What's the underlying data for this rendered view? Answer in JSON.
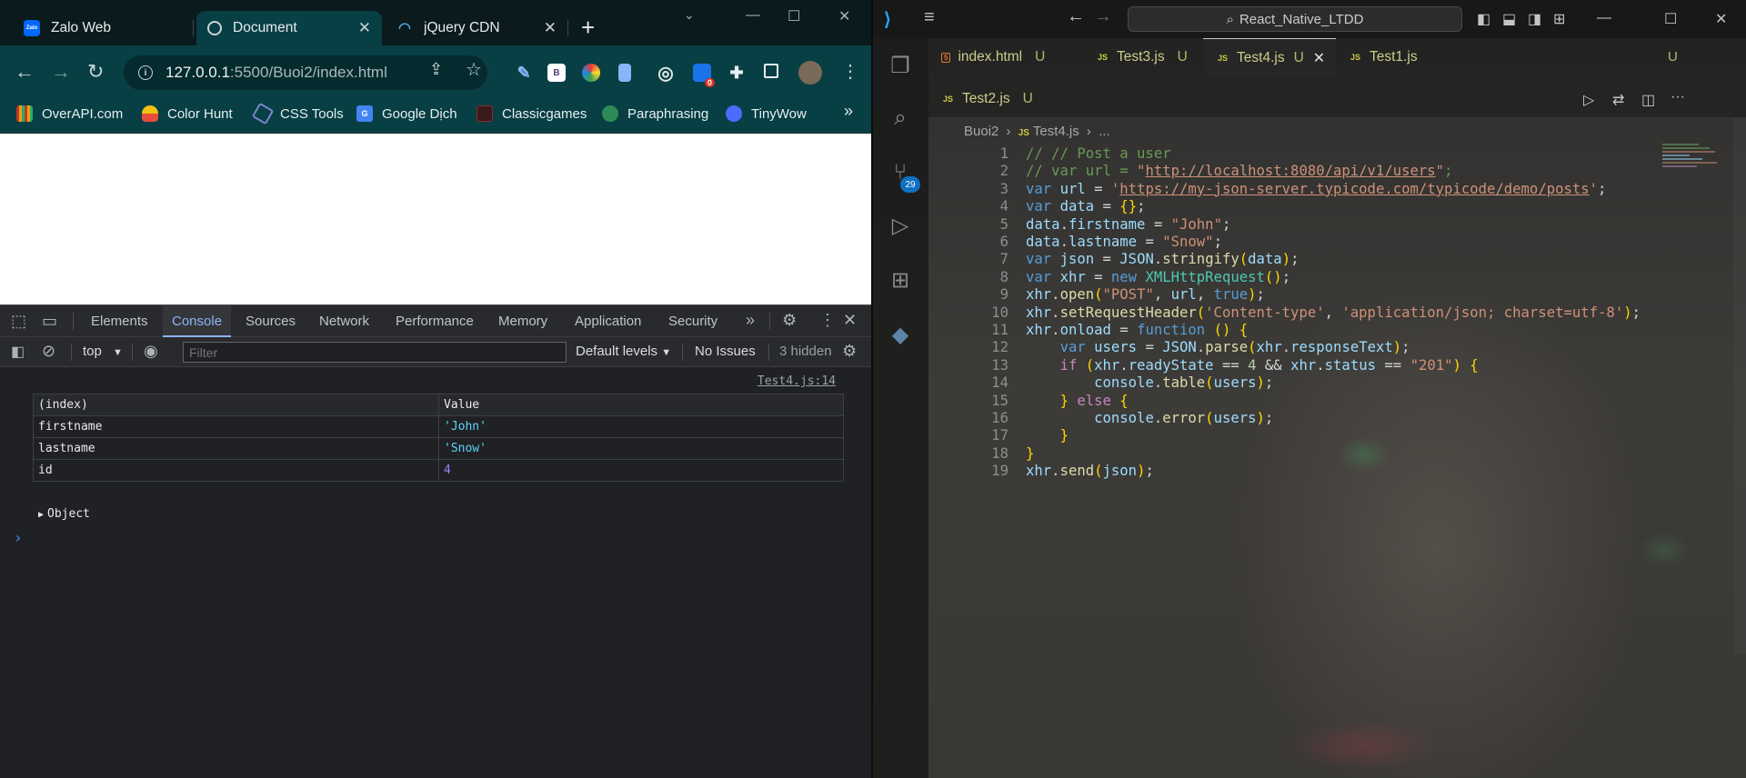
{
  "chrome": {
    "tabs": [
      {
        "title": "Zalo Web",
        "favicon": "zalo-icon",
        "fav_color": "#0068ff",
        "fav_text": "Zalo",
        "active": false
      },
      {
        "title": "Document",
        "favicon": "globe-icon",
        "fav_color": "#5f6368",
        "fav_text": "",
        "active": true
      },
      {
        "title": "jQuery CDN",
        "favicon": "jquery-icon",
        "fav_color": "#0769ad",
        "fav_text": "",
        "active": false
      }
    ],
    "new_tab_symbol": "+",
    "window_controls": {
      "minimize": "—",
      "restore": "☐",
      "collapse": "⌄"
    },
    "nav": {
      "back": "←",
      "forward": "→",
      "reload": "↻"
    },
    "url": {
      "host": "127.0.0.1",
      "path": ":5500/Buoi2/index.html"
    },
    "omnibox_icons": {
      "share": "⇪",
      "star": "☆"
    },
    "extensions": [
      {
        "name": "eyedropper-extension-icon",
        "label": "",
        "color": "#3c6a9c"
      },
      {
        "name": "bootstrap-extension-icon",
        "label": "B",
        "color": "#ffffff"
      },
      {
        "name": "color-wheel-extension-icon",
        "label": "",
        "color": "#2e7d32"
      },
      {
        "name": "clipboard-extension-icon",
        "label": "",
        "color": "#8ab4f8"
      },
      {
        "name": "target-extension-icon",
        "label": "◎",
        "color": "#6b7a7c"
      },
      {
        "name": "ublock-extension-icon",
        "label": "0",
        "color": "#1a73e8"
      },
      {
        "name": "puzzle-icon",
        "label": "✚",
        "color": "#073f44"
      },
      {
        "name": "sidepanel-icon",
        "label": "",
        "color": "#073f44"
      },
      {
        "name": "profile-avatar-icon",
        "label": "",
        "color": "#7a6a5a"
      }
    ],
    "menu_symbol": "⋮",
    "bookmarks": [
      {
        "label": "OverAPI.com",
        "icon": "overapi-icon",
        "color": "#c0392b"
      },
      {
        "label": "Color Hunt",
        "icon": "colorhunt-icon",
        "color": "#f1c40f"
      },
      {
        "label": "CSS Tools",
        "icon": "csstools-icon",
        "color": "#3949ab"
      },
      {
        "label": "Google Dịch",
        "icon": "google-translate-icon",
        "color": "#4285f4"
      },
      {
        "label": "Classicgames",
        "icon": "classicgames-icon",
        "color": "#8e2a2a"
      },
      {
        "label": "Paraphrasing",
        "icon": "paraphrasing-icon",
        "color": "#2e8b57"
      },
      {
        "label": "TinyWow",
        "icon": "tinywow-icon",
        "color": "#4d6bfe"
      }
    ],
    "bookmarks_more": "»"
  },
  "devtools": {
    "tabs": [
      "Elements",
      "Console",
      "Sources",
      "Network",
      "Performance",
      "Memory",
      "Application",
      "Security"
    ],
    "active_tab": "Console",
    "more_tabs_symbol": "»",
    "context": "top",
    "filter_placeholder": "Filter",
    "levels": "Default levels",
    "issues": "No Issues",
    "hidden": "3 hidden",
    "console": {
      "source_link": "Test4.js:14",
      "table": {
        "headers": [
          "(index)",
          "Value"
        ],
        "rows": [
          {
            "key": "firstname",
            "value": "'John'",
            "type": "string"
          },
          {
            "key": "lastname",
            "value": "'Snow'",
            "type": "string"
          },
          {
            "key": "id",
            "value": "4",
            "type": "number"
          }
        ]
      },
      "object_label": "Object",
      "prompt_symbol": "›"
    }
  },
  "vscode": {
    "search": "React_Native_LTDD",
    "tabs_row1": [
      {
        "name": "index.html",
        "type": "html",
        "status": "U",
        "active": false
      },
      {
        "name": "Test3.js",
        "type": "js",
        "status": "U",
        "active": false
      },
      {
        "name": "Test4.js",
        "type": "js",
        "status": "U",
        "active": true
      },
      {
        "name": "Test1.js",
        "type": "js",
        "status": "U",
        "active": false
      }
    ],
    "tabs_row2": [
      {
        "name": "Test2.js",
        "type": "js",
        "status": "U",
        "active": false
      }
    ],
    "breadcrumb": [
      "Buoi2",
      "Test4.js",
      "..."
    ],
    "scm_badge": "29",
    "code_lines": [
      "// // Post a user",
      "// var url = \"http://localhost:8080/api/v1/users\";",
      "var url = 'https://my-json-server.typicode.com/typicode/demo/posts';",
      "var data = {};",
      "data.firstname = \"John\";",
      "data.lastname = \"Snow\";",
      "var json = JSON.stringify(data);",
      "var xhr = new XMLHttpRequest();",
      "xhr.open(\"POST\", url, true);",
      "xhr.setRequestHeader('Content-type', 'application/json; charset=utf-8');",
      "xhr.onload = function () {",
      "    var users = JSON.parse(xhr.responseText);",
      "    if (xhr.readyState == 4 && xhr.status == \"201\") {",
      "        console.table(users);",
      "    } else {",
      "        console.error(users);",
      "    }",
      "}",
      "xhr.send(json);"
    ]
  }
}
